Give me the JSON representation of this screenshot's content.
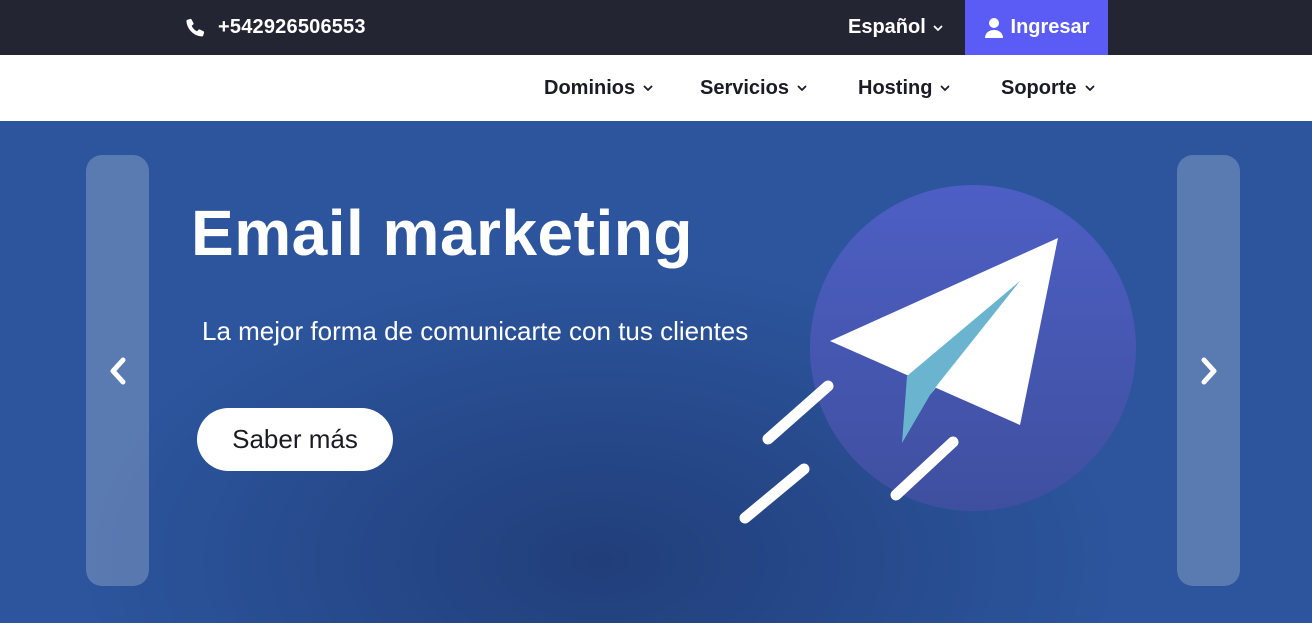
{
  "topbar": {
    "phone": "+542926506553",
    "phone_icon": "phone-icon",
    "language": "Español",
    "login_label": "Ingresar",
    "login_icon": "user-icon",
    "background": "#232532",
    "login_background": "#5b5cf6"
  },
  "nav": {
    "items": [
      {
        "label": "Dominios"
      },
      {
        "label": "Servicios"
      },
      {
        "label": "Hosting"
      },
      {
        "label": "Soporte"
      }
    ]
  },
  "hero": {
    "title": "Email marketing",
    "subtitle": "La mejor forma de comunicarte con tus clientes",
    "cta_label": "Saber más",
    "prev_icon": "chevron-left-icon",
    "next_icon": "chevron-right-icon",
    "illustration": "paper-plane-icon",
    "background": "#2c559d",
    "circle_color": "#4a5bbd",
    "plane_accent": "#6ab4cf"
  }
}
